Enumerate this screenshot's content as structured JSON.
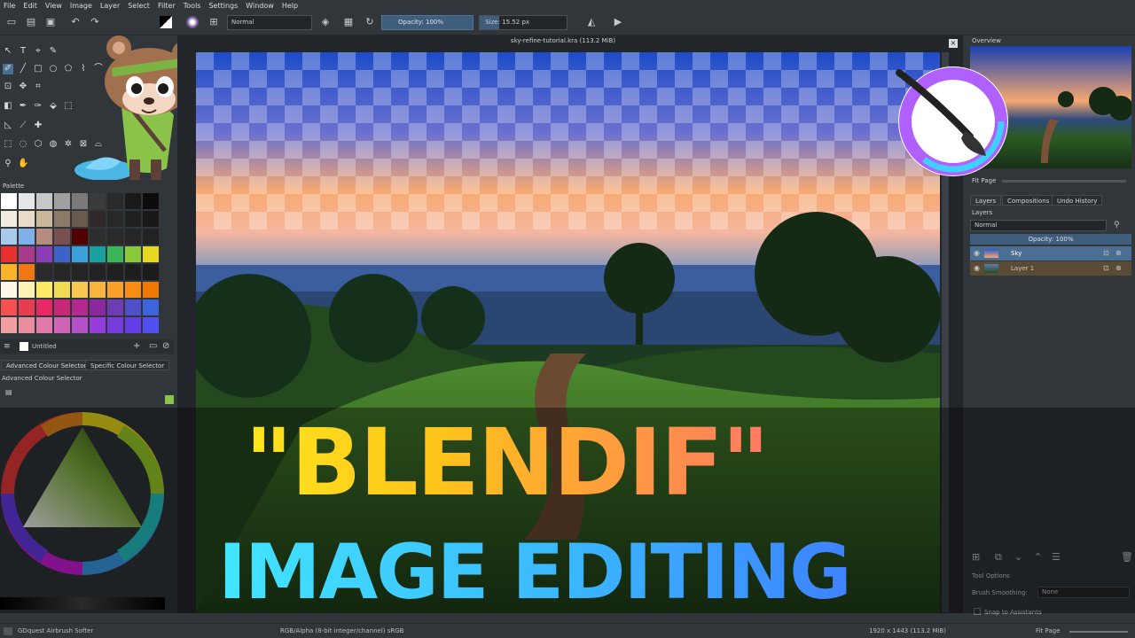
{
  "menu": [
    "File",
    "Edit",
    "View",
    "Image",
    "Layer",
    "Select",
    "Filter",
    "Tools",
    "Settings",
    "Window",
    "Help"
  ],
  "toolbar": {
    "blend_mode": "Normal",
    "opacity_label": "Opacity:",
    "opacity_value": "100%",
    "size_label": "Size:",
    "size_value": "15.52 px"
  },
  "canvas": {
    "document_title": "sky-refine-tutorial.kra (113.2 MiB)"
  },
  "palette": {
    "title": "Palette",
    "name": "Untitled",
    "swatch_colors": [
      "#ffffff",
      "#e6e6e6",
      "#c8c8c8",
      "#a0a0a0",
      "#7a7a7a",
      "#3a3a3a",
      "#2a2a2a",
      "#1a1a1a",
      "#0c0c0c",
      "#f2ece0",
      "#e8dcc8",
      "#cbb79b",
      "#8c7a68",
      "#6a5a4e",
      "#302828",
      "#282828",
      "#202020",
      "#181818",
      "#a8c8ec",
      "#80b0e8",
      "#b48c80",
      "#785050",
      "#500000",
      "#2e2e2e",
      "#2a2a2a",
      "#262626",
      "#222222",
      "#e83030",
      "#a83c8c",
      "#8c3cb4",
      "#3c64c8",
      "#3ca0dc",
      "#1aa0a0",
      "#3cb45a",
      "#8cc83c",
      "#e8d820",
      "#fab428",
      "#f07814",
      "#2a2a2a",
      "#262626",
      "#242424",
      "#222222",
      "#202020",
      "#1e1e1e",
      "#1c1c1c",
      "#fff8e8",
      "#fff0b4",
      "#ffe864",
      "#f0dc50",
      "#f8c850",
      "#f8b43c",
      "#f8a028",
      "#f88c14",
      "#f07800",
      "#f85050",
      "#e83c50",
      "#e82864",
      "#c82878",
      "#b42890",
      "#8c28a0",
      "#6e3cb4",
      "#5050c8",
      "#3c64dc",
      "#f0a0a0",
      "#e88ca0",
      "#e078a8",
      "#d064b4",
      "#b450c8",
      "#963cdc",
      "#783cdc",
      "#643ce8",
      "#5050f0"
    ]
  },
  "colour_selector": {
    "tab_advanced": "Advanced Colour Selector",
    "tab_specific": "Specific Colour Selector",
    "title": "Advanced Colour Selector"
  },
  "overview": {
    "title": "Overview",
    "zoom_label": "Fit Page"
  },
  "layers": {
    "tabs": [
      "Layers",
      "Compositions",
      "Undo History"
    ],
    "title": "Layers",
    "blend_mode": "Normal",
    "opacity_label": "Opacity:",
    "opacity_value": "100%",
    "items": [
      {
        "name": "Sky",
        "selected": true
      },
      {
        "name": "Layer 1",
        "selected": false
      }
    ]
  },
  "tool_options": {
    "title": "Tool Options",
    "smoothing_label": "Brush Smoothing:",
    "smoothing_value": "None",
    "snap_label": "Snap to Assistants"
  },
  "status": {
    "brush": "GDquest Airbrush Softer",
    "color_space": "RGB/Alpha (8-bit integer/channel)  sRGB",
    "dimensions": "1920 x 1443 (113.2 MiB)",
    "zoom": "Fit Page"
  },
  "overlay": {
    "headline1": "\"BLENDIF\"",
    "headline2": "IMAGE EDITING"
  },
  "colors": {
    "selected_layer": "#4a6f93",
    "headline_yellow": "#ffe51e",
    "headline_pink": "#ff5f8c",
    "headline_cyan": "#42e6ff",
    "headline_blue": "#3f74ff"
  }
}
